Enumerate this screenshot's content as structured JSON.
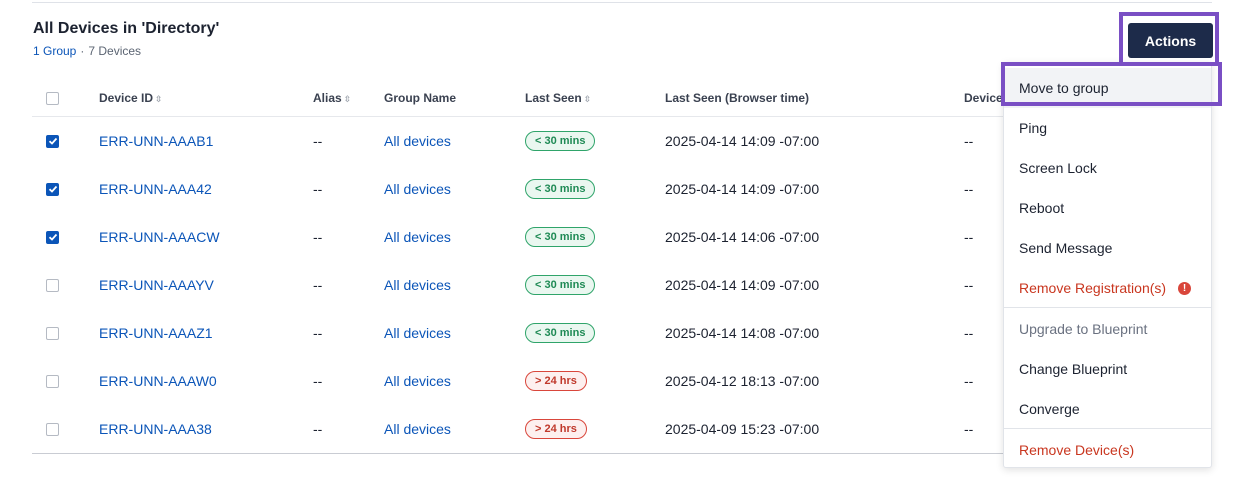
{
  "header": {
    "title": "All Devices in 'Directory'",
    "group_link": "1 Group",
    "separator": "·",
    "device_count": "7 Devices"
  },
  "actions": {
    "label": "Actions"
  },
  "table": {
    "columns": {
      "device_id": "Device ID",
      "alias": "Alias",
      "group_name": "Group Name",
      "last_seen": "Last Seen",
      "last_seen_browser": "Last Seen (Browser time)",
      "device": "Device"
    },
    "sort_icon": "sort-icon",
    "rows": [
      {
        "checked": true,
        "device_id": "ERR-UNN-AAAB1",
        "alias": "--",
        "group": "All devices",
        "last_seen": "< 30 mins",
        "status": "green",
        "browser_time": "2025-04-14 14:09 -07:00",
        "device": "--"
      },
      {
        "checked": true,
        "device_id": "ERR-UNN-AAA42",
        "alias": "--",
        "group": "All devices",
        "last_seen": "< 30 mins",
        "status": "green",
        "browser_time": "2025-04-14 14:09 -07:00",
        "device": "--"
      },
      {
        "checked": true,
        "device_id": "ERR-UNN-AAACW",
        "alias": "--",
        "group": "All devices",
        "last_seen": "< 30 mins",
        "status": "green",
        "browser_time": "2025-04-14 14:06 -07:00",
        "device": "--"
      },
      {
        "checked": false,
        "device_id": "ERR-UNN-AAAYV",
        "alias": "--",
        "group": "All devices",
        "last_seen": "< 30 mins",
        "status": "green",
        "browser_time": "2025-04-14 14:09 -07:00",
        "device": "--"
      },
      {
        "checked": false,
        "device_id": "ERR-UNN-AAAZ1",
        "alias": "--",
        "group": "All devices",
        "last_seen": "< 30 mins",
        "status": "green",
        "browser_time": "2025-04-14 14:08 -07:00",
        "device": "--"
      },
      {
        "checked": false,
        "device_id": "ERR-UNN-AAAW0",
        "alias": "--",
        "group": "All devices",
        "last_seen": "> 24 hrs",
        "status": "red",
        "browser_time": "2025-04-12 18:13 -07:00",
        "device": "--"
      },
      {
        "checked": false,
        "device_id": "ERR-UNN-AAA38",
        "alias": "--",
        "group": "All devices",
        "last_seen": "> 24 hrs",
        "status": "red",
        "browser_time": "2025-04-09 15:23 -07:00",
        "device": "--"
      }
    ]
  },
  "menu": {
    "items": [
      {
        "label": "Move to group",
        "variant": "active"
      },
      {
        "label": "Ping",
        "variant": "normal"
      },
      {
        "label": "Screen Lock",
        "variant": "normal"
      },
      {
        "label": "Reboot",
        "variant": "normal"
      },
      {
        "label": "Send Message",
        "variant": "normal"
      },
      {
        "label": "Remove Registration(s)",
        "variant": "danger",
        "warn_icon": "!"
      },
      {
        "label": "Upgrade to Blueprint",
        "variant": "disabled"
      },
      {
        "label": "Change Blueprint",
        "variant": "normal"
      },
      {
        "label": "Converge",
        "variant": "normal"
      },
      {
        "label": "Remove Device(s)",
        "variant": "danger"
      }
    ]
  },
  "colors": {
    "link": "#0b55b8",
    "actions_bg": "#1d2b4a",
    "highlight": "#7a4fc4",
    "danger": "#c9361f",
    "status_green": "#2fa46a",
    "status_red": "#d9463b"
  }
}
